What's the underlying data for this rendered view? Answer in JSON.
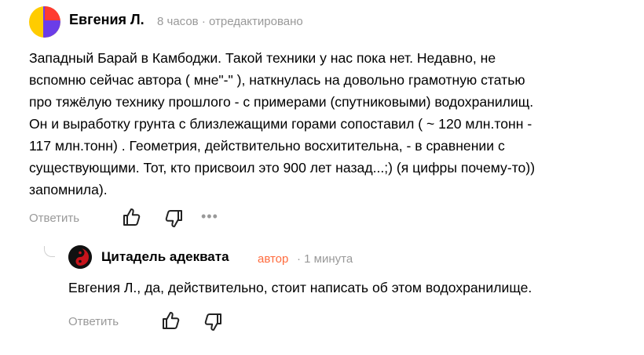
{
  "comment": {
    "author": "Евгения Л.",
    "meta": "8 часов · отредактировано",
    "text": "Западный Барай в Камбоджи. Такой техники у нас пока нет. Недавно, не\nвспомню сейчас автора ( мне\"-\" ), наткнулась на довольно грамотную статью\nпро тяжёлую технику прошлого - с примерами (спутниковыми) водохранилищ.\nОн и выработку грунта с близлежащими горами сопоставил ( ~ 120 млн.тонн -\n117 млн.тонн) . Геометрия, действительно восхитительна, - в сравнении с\nсуществующими. Тот, кто присвоил это 900 лет назад...;) (я цифры почему-то))\nзапомнила).",
    "reply_label": "Ответить",
    "more_label": "•••",
    "colors": {
      "avatar_yellow": "#ffcc00",
      "avatar_purple": "#6b3de8",
      "avatar_red": "#ff3b30"
    }
  },
  "reply": {
    "author": "Цитадель адеквата",
    "badge": "автор",
    "meta": "· 1 минута",
    "text": "Евгения Л., да, действительно, стоит написать об этом водохранилище.",
    "reply_label": "Ответить",
    "colors": {
      "badge": "#ff6b3d"
    }
  },
  "icons": {
    "like": "thumbs-up-icon",
    "dislike": "thumbs-down-icon",
    "more": "more-dots-icon",
    "avatar2": "yin-yang-icon"
  }
}
